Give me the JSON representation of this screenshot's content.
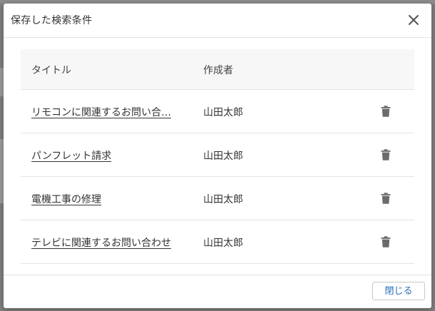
{
  "modal": {
    "title": "保存した検索条件",
    "close_label": "閉じる"
  },
  "table": {
    "headers": {
      "title": "タイトル",
      "author": "作成者"
    },
    "rows": [
      {
        "title": "リモコンに関連するお問い合…",
        "author": "山田太郎"
      },
      {
        "title": "パンフレット請求",
        "author": "山田太郎"
      },
      {
        "title": "電機工事の修理",
        "author": "山田太郎"
      },
      {
        "title": "テレビに関連するお問い合わせ",
        "author": "山田太郎"
      }
    ]
  },
  "icons": {
    "close": "close-icon",
    "delete": "trash-icon"
  },
  "colors": {
    "accent": "#2a6fb8",
    "icon": "#6b6b6b",
    "border": "#e3e3e3",
    "header_bg": "#f7f7f7",
    "overlay": "#7e7e7e"
  }
}
